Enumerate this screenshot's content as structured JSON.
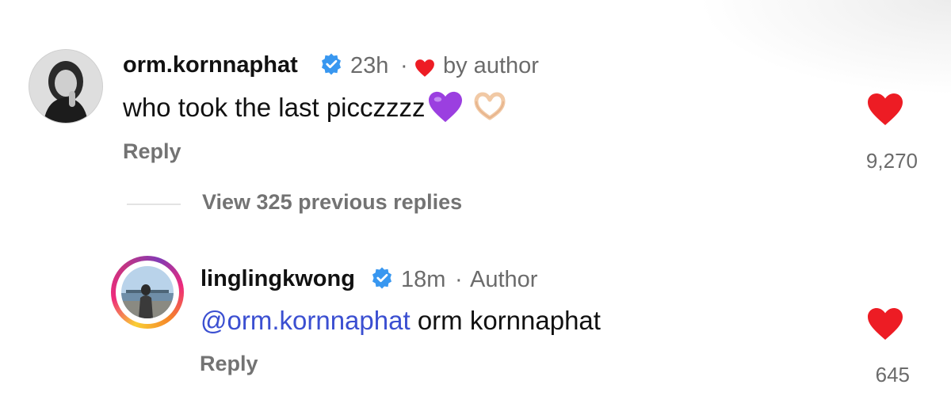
{
  "comments": [
    {
      "username": "orm.kornnaphat",
      "verified": true,
      "time": "23h",
      "separator": "·",
      "liked_by_author_label": "by author",
      "text": "who took the last picczzzz",
      "emojis": [
        "purple-heart-icon",
        "heart-hands-icon"
      ],
      "reply_label": "Reply",
      "like_count": "9,270",
      "liked": true
    },
    {
      "username": "linglingkwong",
      "verified": true,
      "time": "18m",
      "separator": "·",
      "author_badge": "Author",
      "mention": "@orm.kornnaphat",
      "text": "orm kornnaphat",
      "reply_label": "Reply",
      "like_count": "645",
      "liked": true
    }
  ],
  "view_replies_label": "View 325 previous replies",
  "colors": {
    "like_red": "#ed1c24",
    "verified_blue": "#3897f0",
    "mention_blue": "#3b4fd1",
    "muted_gray": "#737373"
  }
}
